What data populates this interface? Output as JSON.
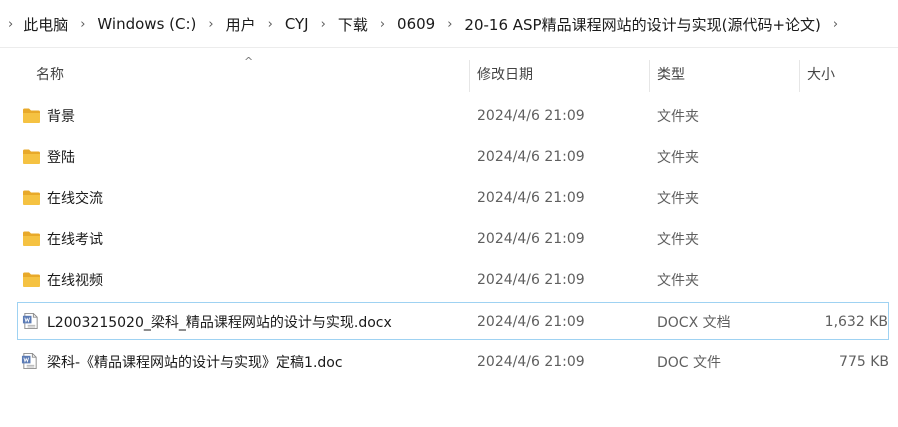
{
  "breadcrumb": {
    "items": [
      "此电脑",
      "Windows (C:)",
      "用户",
      "CYJ",
      "下载",
      "0609",
      "20-16 ASP精品课程网站的设计与实现(源代码+论文)"
    ],
    "separator": "›"
  },
  "columns": {
    "name": "名称",
    "modified": "修改日期",
    "type": "类型",
    "size": "大小",
    "sort_indicator": "^"
  },
  "files": [
    {
      "name": "背景",
      "modified": "2024/4/6 21:09",
      "type": "文件夹",
      "size": "",
      "icon": "folder-icon"
    },
    {
      "name": "登陆",
      "modified": "2024/4/6 21:09",
      "type": "文件夹",
      "size": "",
      "icon": "folder-icon"
    },
    {
      "name": "在线交流",
      "modified": "2024/4/6 21:09",
      "type": "文件夹",
      "size": "",
      "icon": "folder-icon"
    },
    {
      "name": "在线考试",
      "modified": "2024/4/6 21:09",
      "type": "文件夹",
      "size": "",
      "icon": "folder-icon"
    },
    {
      "name": "在线视频",
      "modified": "2024/4/6 21:09",
      "type": "文件夹",
      "size": "",
      "icon": "folder-icon"
    },
    {
      "name": "L2003215020_梁科_精品课程网站的设计与实现.docx",
      "modified": "2024/4/6 21:09",
      "type": "DOCX 文档",
      "size": "1,632 KB",
      "icon": "document-icon",
      "selected": true
    },
    {
      "name": "梁科-《精品课程网站的设计与实现》定稿1.doc",
      "modified": "2024/4/6 21:09",
      "type": "DOC 文件",
      "size": "775 KB",
      "icon": "document-icon"
    }
  ],
  "colors": {
    "folder": "#f5c242",
    "folder_tab": "#e8a92a",
    "selection_border": "#9fd2f2"
  }
}
